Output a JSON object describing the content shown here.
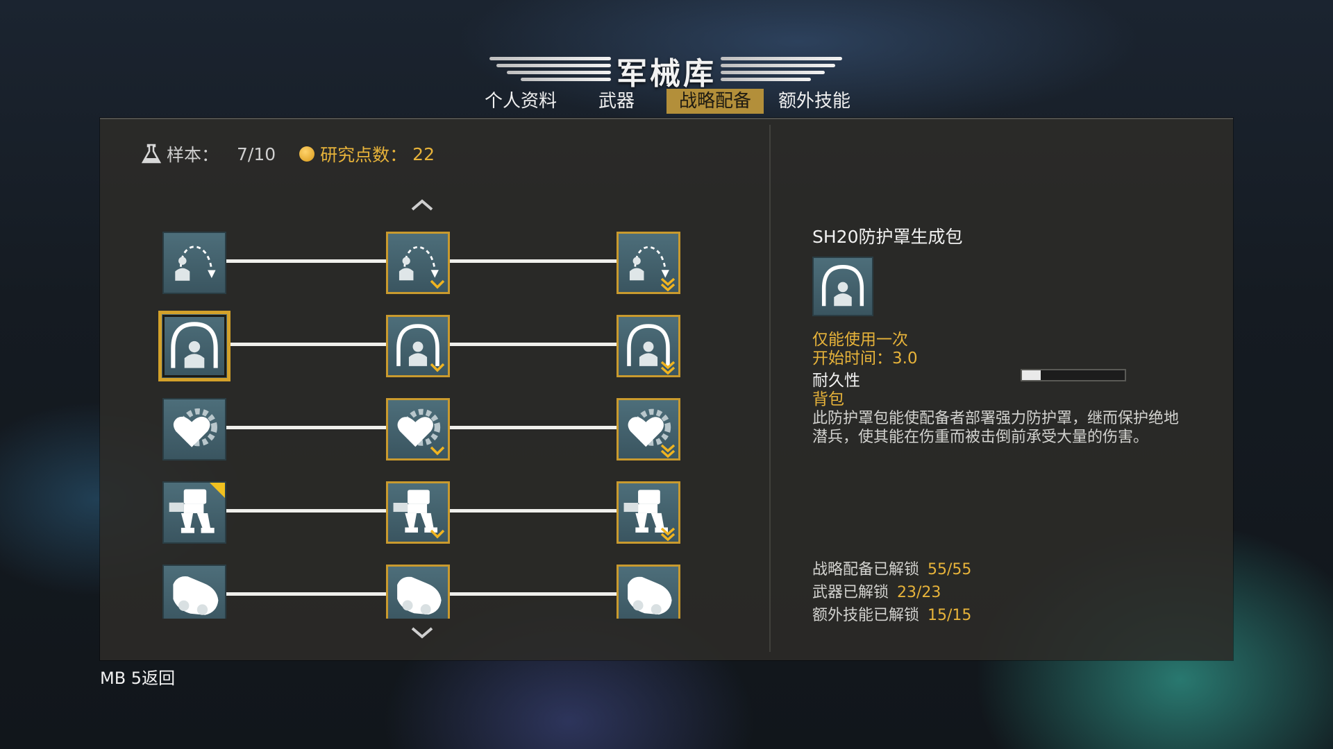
{
  "header": {
    "title": "军械库",
    "tabs": [
      {
        "label": "个人资料",
        "active": false
      },
      {
        "label": "武器",
        "active": false
      },
      {
        "label": "战略配备",
        "active": true
      },
      {
        "label": "额外技能",
        "active": false
      }
    ]
  },
  "resources": {
    "samples_label": "样本：",
    "samples_value": "7/10",
    "research_label": "研究点数：",
    "research_value": "22"
  },
  "tree": {
    "rows": [
      {
        "icon": "airdrop-icon",
        "tiers": 3,
        "new_badge": false
      },
      {
        "icon": "shield-dome-icon",
        "tiers": 3,
        "new_badge": false,
        "selected_tier": 1
      },
      {
        "icon": "heart-gear-icon",
        "tiers": 3,
        "new_badge": false
      },
      {
        "icon": "mech-icon",
        "tiers": 3,
        "new_badge": true
      },
      {
        "icon": "vehicle-icon",
        "tiers": 3,
        "new_badge": false
      }
    ]
  },
  "detail": {
    "title": "SH20防护罩生成包",
    "icon": "shield-dome-icon",
    "uses": "仅能使用一次",
    "start_time": "开始时间：3.0",
    "durability_label": "耐久性",
    "durability_level": 0.18,
    "slot": "背包",
    "description": "此防护罩包能使配备者部署强力防护罩，继而保护绝地潜兵，使其能在伤重而被击倒前承受大量的伤害。"
  },
  "summary": [
    {
      "label": "战略配备已解锁",
      "value": "55/55"
    },
    {
      "label": "武器已解锁",
      "value": "23/23"
    },
    {
      "label": "额外技能已解锁",
      "value": "15/15"
    }
  ],
  "footer": {
    "back_label": "MB 5返回"
  },
  "colors": {
    "accent_gold": "#e7b33a",
    "tile_blue": "#4d6e7a",
    "panel": "#2c2b28"
  }
}
